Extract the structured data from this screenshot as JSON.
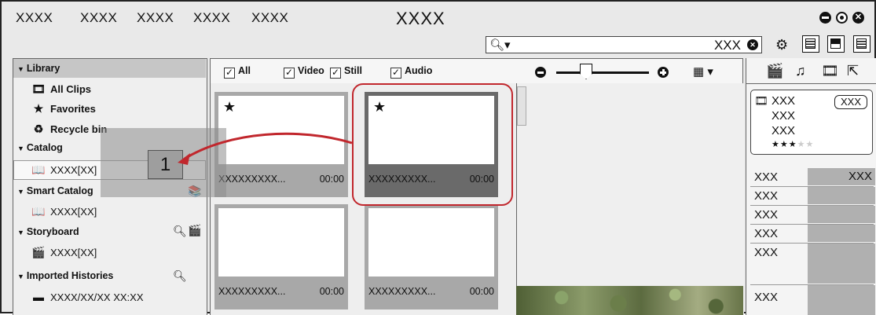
{
  "menubar": {
    "items": [
      "XXXX",
      "XXXX",
      "XXXX",
      "XXXX",
      "XXXX"
    ],
    "title": "XXXX"
  },
  "search": {
    "value": "XXX"
  },
  "sidebar": {
    "library": "Library",
    "all_clips": "All Clips",
    "favorites": "Favorites",
    "recycle_bin": "Recycle bin",
    "catalog": "Catalog",
    "catalog_item": "XXXX[XX]",
    "smart_catalog": "Smart Catalog",
    "smart_item": "XXXX[XX]",
    "storyboard": "Storyboard",
    "storyboard_item": "XXXX[XX]",
    "imported": "Imported Histories",
    "imported_item": "XXXX/XX/XX XX:XX"
  },
  "drag_badge": "1",
  "filters": {
    "all": "All",
    "video": "Video",
    "still": "Still",
    "audio": "Audio",
    "checked": "✓"
  },
  "clips": [
    {
      "name": "XXXXXXXXX...",
      "duration": "00:00",
      "favorite": true
    },
    {
      "name": "XXXXXXXXX...",
      "duration": "00:00",
      "favorite": true
    },
    {
      "name": "XXXXXXXXX...",
      "duration": "00:00",
      "favorite": false
    },
    {
      "name": "XXXXXXXXX...",
      "duration": "00:00",
      "favorite": false
    }
  ],
  "right_panel": {
    "card_line1": "XXX",
    "card_line2": "XXX",
    "card_line3": "XXX",
    "card_badge": "XXX",
    "rating": 3,
    "props": [
      {
        "key": "XXX",
        "value": "XXX"
      },
      {
        "key": "XXX",
        "value": ""
      },
      {
        "key": "XXX",
        "value": ""
      },
      {
        "key": "XXX",
        "value": ""
      },
      {
        "key": "XXX",
        "value": ""
      },
      {
        "key": "XXX",
        "value": ""
      }
    ]
  },
  "icons": {
    "search": "search-icon",
    "gear": "gear-icon",
    "star": "star-icon",
    "clip": "clip-icon",
    "book": "book-icon",
    "folder": "folder-icon"
  },
  "colors": {
    "highlight": "#c1272d",
    "selected_clip": "#6a6a6a",
    "clip_frame": "#a8a8a8"
  }
}
